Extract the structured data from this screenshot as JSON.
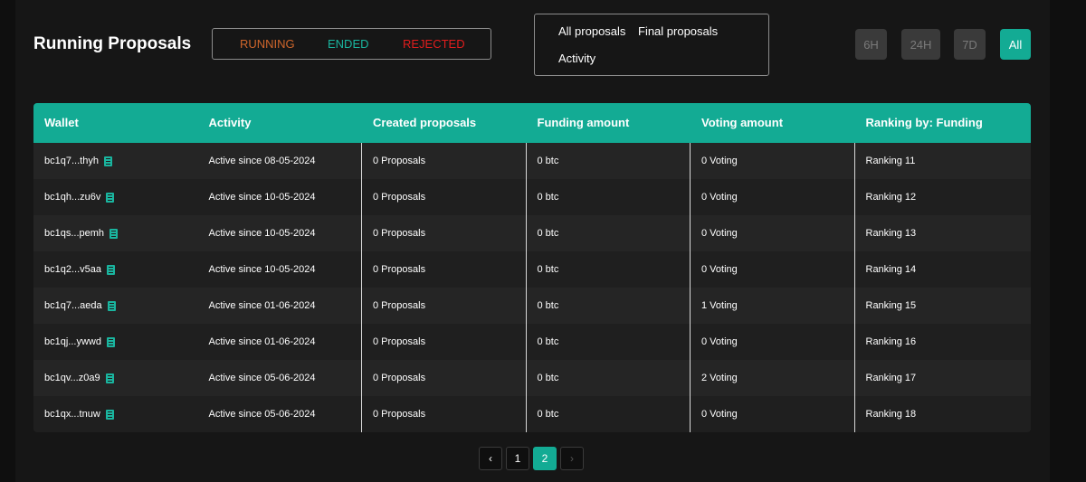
{
  "header": {
    "title": "Running Proposals"
  },
  "status_filter": {
    "running": "RUNNING",
    "ended": "ENDED",
    "rejected": "REJECTED"
  },
  "proposal_filter": {
    "all": "All proposals",
    "final": "Final proposals",
    "activity": "Activity"
  },
  "time_filter": {
    "h6": "6H",
    "h24": "24H",
    "d7": "7D",
    "all": "All",
    "selected": "All"
  },
  "table": {
    "columns": [
      "Wallet",
      "Activity",
      "Created proposals",
      "Funding amount",
      "Voting amount",
      "Ranking by: Funding"
    ],
    "rows": [
      {
        "wallet": "bc1q7...thyh",
        "activity": "Active since 08-05-2024",
        "proposals": "0 Proposals",
        "funding": "0 btc",
        "voting": "0 Voting",
        "ranking": "Ranking 11"
      },
      {
        "wallet": "bc1qh...zu6v",
        "activity": "Active since 10-05-2024",
        "proposals": "0 Proposals",
        "funding": "0 btc",
        "voting": "0 Voting",
        "ranking": "Ranking 12"
      },
      {
        "wallet": "bc1qs...pemh",
        "activity": "Active since 10-05-2024",
        "proposals": "0 Proposals",
        "funding": "0 btc",
        "voting": "0 Voting",
        "ranking": "Ranking 13"
      },
      {
        "wallet": "bc1q2...v5aa",
        "activity": "Active since 10-05-2024",
        "proposals": "0 Proposals",
        "funding": "0 btc",
        "voting": "0 Voting",
        "ranking": "Ranking 14"
      },
      {
        "wallet": "bc1q7...aeda",
        "activity": "Active since 01-06-2024",
        "proposals": "0 Proposals",
        "funding": "0 btc",
        "voting": "1 Voting",
        "ranking": "Ranking 15"
      },
      {
        "wallet": "bc1qj...ywwd",
        "activity": "Active since 01-06-2024",
        "proposals": "0 Proposals",
        "funding": "0 btc",
        "voting": "0 Voting",
        "ranking": "Ranking 16"
      },
      {
        "wallet": "bc1qv...z0a9",
        "activity": "Active since 05-06-2024",
        "proposals": "0 Proposals",
        "funding": "0 btc",
        "voting": "2 Voting",
        "ranking": "Ranking 17"
      },
      {
        "wallet": "bc1qx...tnuw",
        "activity": "Active since 05-06-2024",
        "proposals": "0 Proposals",
        "funding": "0 btc",
        "voting": "0 Voting",
        "ranking": "Ranking 18"
      }
    ]
  },
  "pagination": {
    "prev": "‹",
    "pages": [
      "1",
      "2"
    ],
    "current": "2",
    "next": "›"
  },
  "colors": {
    "accent": "#13ab94",
    "running": "#d0662b",
    "ended": "#1ab59f",
    "rejected": "#e11d1d"
  }
}
